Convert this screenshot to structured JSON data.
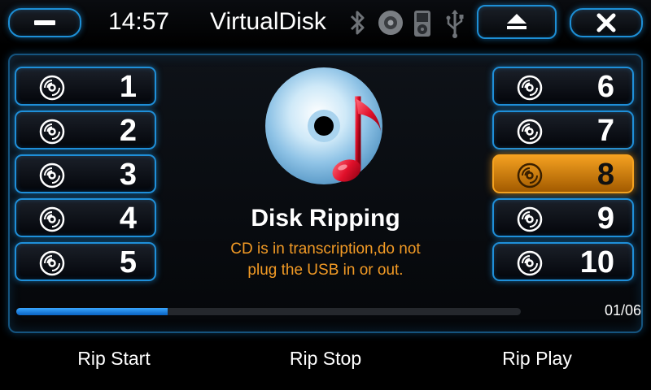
{
  "header": {
    "time": "14:57",
    "title": "VirtualDisk",
    "icons": [
      "bluetooth-icon",
      "disc-icon",
      "media-player-icon",
      "usb-icon"
    ],
    "eject_icon": "eject-icon",
    "close_icon": "close-icon",
    "minimize_icon": "minimize-icon"
  },
  "tracks_left": [
    {
      "label": "1"
    },
    {
      "label": "2"
    },
    {
      "label": "3"
    },
    {
      "label": "4"
    },
    {
      "label": "5"
    }
  ],
  "tracks_right": [
    {
      "label": "6"
    },
    {
      "label": "7"
    },
    {
      "label": "8",
      "active": true
    },
    {
      "label": "9"
    },
    {
      "label": "10"
    }
  ],
  "status": {
    "title": "Disk Ripping",
    "message_line1": "CD is in transcription,do not",
    "message_line2": "plug the USB in or out."
  },
  "progress": {
    "fraction": 0.3,
    "counter": "01/06"
  },
  "bottom": {
    "rip_start": "Rip Start",
    "rip_stop": "Rip Stop",
    "rip_play": "Rip Play"
  },
  "colors": {
    "accent": "#1f8fd9",
    "active": "#f5a21f",
    "warning_text": "#f29a25"
  }
}
